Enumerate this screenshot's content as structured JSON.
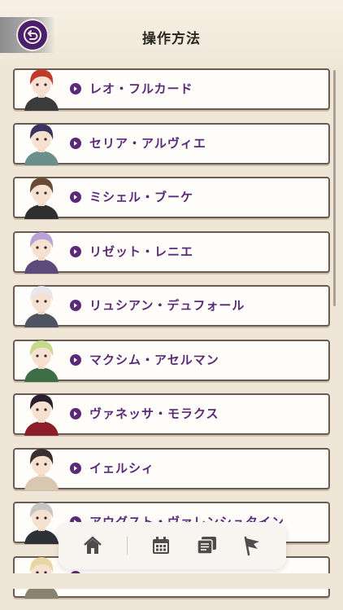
{
  "header": {
    "title": "操作方法"
  },
  "characters": [
    {
      "name": "レオ・フルカード",
      "hair": "#c0392b",
      "outfit": "#3b3b3b"
    },
    {
      "name": "セリア・アルヴィエ",
      "hair": "#3b3360",
      "outfit": "#6b8f8c"
    },
    {
      "name": "ミシェル・ブーケ",
      "hair": "#6a4a36",
      "outfit": "#2f2f2f"
    },
    {
      "name": "リゼット・レニエ",
      "hair": "#b9a3d6",
      "outfit": "#5e4a7a"
    },
    {
      "name": "リュシアン・デュフォール",
      "hair": "#e8e8ec",
      "outfit": "#4d5360"
    },
    {
      "name": "マクシム・アセルマン",
      "hair": "#c7d98a",
      "outfit": "#3f6d45"
    },
    {
      "name": "ヴァネッサ・モラクス",
      "hair": "#2b1f2e",
      "outfit": "#8b1e2a"
    },
    {
      "name": "イェルシィ",
      "hair": "#3a3030",
      "outfit": "#d9c7b0"
    },
    {
      "name": "アウグスト・ヴァレンシュタイン",
      "hair": "#c8c6c3",
      "outfit": "#2e3138"
    },
    {
      "name": "",
      "hair": "#e8d7a0",
      "outfit": "#8a8270"
    }
  ],
  "nav": {
    "items": [
      "home-icon",
      "calendar-icon",
      "cards-icon",
      "flag-icon"
    ]
  },
  "colors": {
    "accent": "#5a2a78",
    "background": "#efe6d8",
    "border": "#6b5a52"
  }
}
